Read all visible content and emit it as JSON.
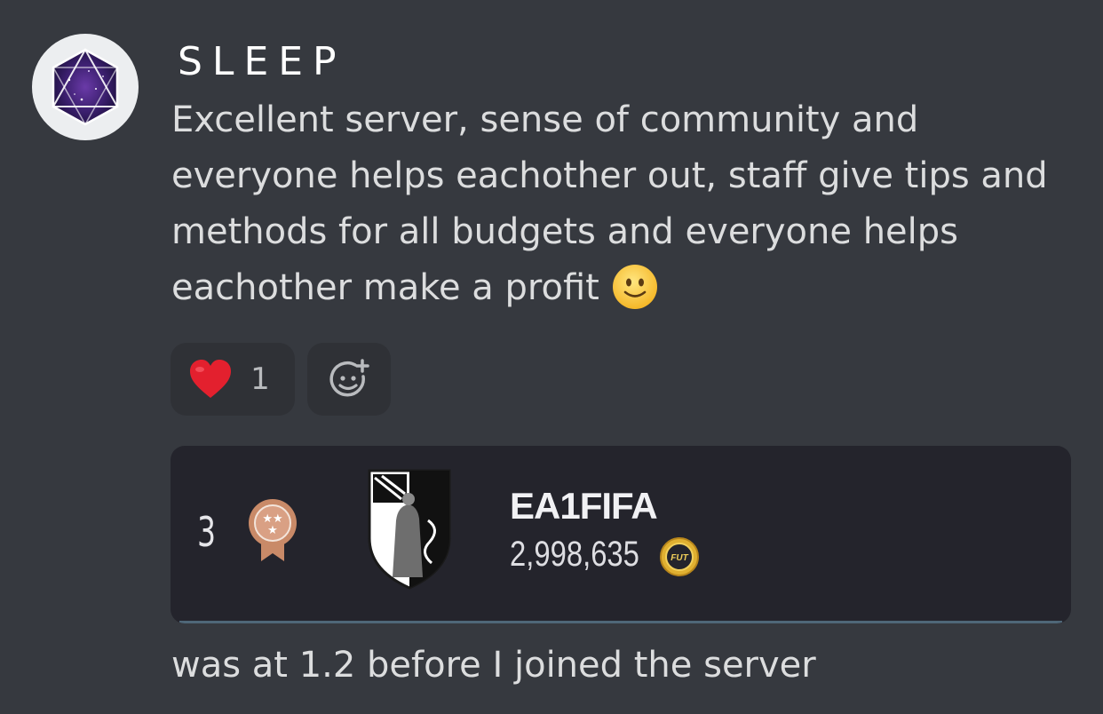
{
  "message": {
    "author": "SLEEP",
    "avatar_icon": "purple-d20-icon",
    "content_lines": [
      "Excellent server, sense of community and",
      "everyone helps eachother out, staff give tips and",
      "methods for all budgets and everyone helps",
      "eachother make a profit"
    ],
    "inline_emoji": "slightly-smiling-face-emoji",
    "followup_text": "was at 1.2 before I joined the server"
  },
  "reactions": [
    {
      "emoji": "red-heart-emoji",
      "count": "1"
    },
    {
      "emoji": "add-reaction-icon"
    }
  ],
  "embed": {
    "rank": "3",
    "medal_icon": "bronze-medal-icon",
    "club_crest": "club-crest-icon",
    "player_name": "EA1FIFA",
    "coins": "2,998,635",
    "coin_icon": "fut-coin-icon",
    "coin_label": "FUT"
  },
  "colors": {
    "background": "#36393f",
    "reaction_bg": "#2f3136",
    "embed_bg": "#24242c",
    "text": "#dcddde"
  }
}
